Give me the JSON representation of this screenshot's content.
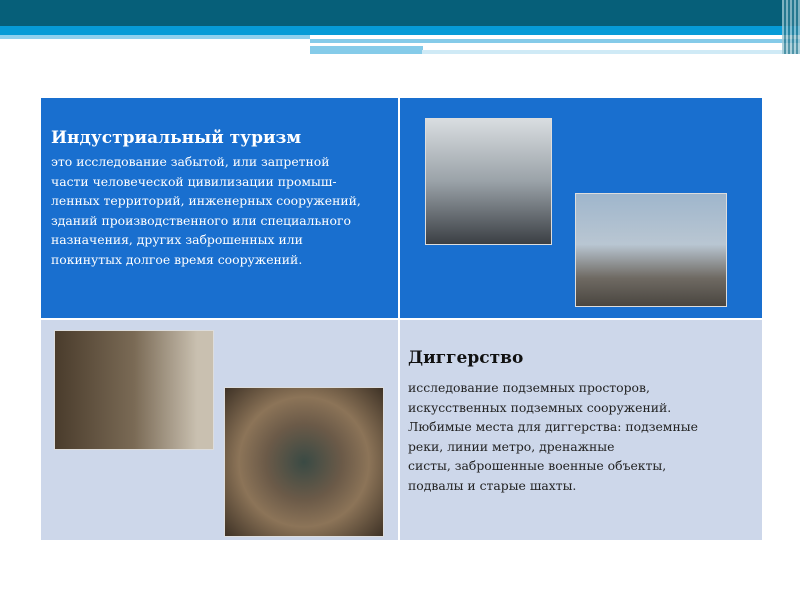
{
  "industrial": {
    "title": "Индустриальный туризм",
    "text": " это исследование забытой, или запретной\nчасти человеческой цивилизации промыш-\nленных  территорий, инженерных сооружений,\nзданий производственного или специального\nназначения, других заброшенных или\nпокинутых долгое время сооружений."
  },
  "digging": {
    "title": "Диггерство",
    "text": " исследование подземных просторов,\nискусственных подземных сооружений.\nЛюбимые места для диггерства: подземные\nреки, линии метро, дренажные\nсисты,  заброшенные  военные  объекты,\nподвалы и старые шахты."
  }
}
